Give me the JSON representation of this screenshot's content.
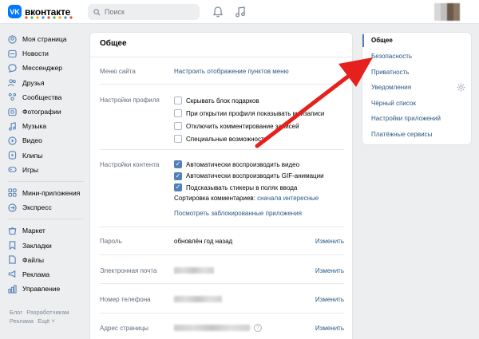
{
  "header": {
    "logo_mark": "VK",
    "logo_text": "вконтакте",
    "search_placeholder": "Поиск"
  },
  "nav": {
    "group1": [
      {
        "label": "Моя страница",
        "icon": "user-circle-icon"
      },
      {
        "label": "Новости",
        "icon": "news-icon"
      },
      {
        "label": "Мессенджер",
        "icon": "chat-icon"
      },
      {
        "label": "Друзья",
        "icon": "friends-icon"
      },
      {
        "label": "Сообщества",
        "icon": "communities-icon"
      },
      {
        "label": "Фотографии",
        "icon": "photo-icon"
      },
      {
        "label": "Музыка",
        "icon": "music-icon"
      },
      {
        "label": "Видео",
        "icon": "video-icon"
      },
      {
        "label": "Клипы",
        "icon": "clips-icon"
      },
      {
        "label": "Игры",
        "icon": "games-icon"
      }
    ],
    "group2": [
      {
        "label": "Мини-приложения",
        "icon": "apps-icon"
      },
      {
        "label": "Экспресс",
        "icon": "express-icon"
      }
    ],
    "group3": [
      {
        "label": "Маркет",
        "icon": "market-icon"
      },
      {
        "label": "Закладки",
        "icon": "bookmark-icon"
      },
      {
        "label": "Файлы",
        "icon": "files-icon"
      },
      {
        "label": "Реклама",
        "icon": "ads-icon"
      },
      {
        "label": "Управление",
        "icon": "manage-icon"
      }
    ],
    "footer": {
      "blog": "Блог",
      "developers": "Разработчикам",
      "ads": "Реклама",
      "more": "Ещё ˅"
    }
  },
  "card": {
    "title": "Общее",
    "site_menu_label": "Меню сайта",
    "site_menu_link": "Настроить отображение пунктов меню",
    "profile_label": "Настройки профиля",
    "profile_options": [
      {
        "label": "Скрывать блок подарков",
        "checked": false
      },
      {
        "label": "При открытии профиля показывать моизаписи",
        "checked": false
      },
      {
        "label": "Отключить комментирование записей",
        "checked": false
      },
      {
        "label": "Специальные возможности",
        "checked": false
      }
    ],
    "content_label": "Настройки контента",
    "content_options": [
      {
        "label": "Автоматически воспроизводить видео",
        "checked": true
      },
      {
        "label": "Автоматически воспроизводить GIF-анимации",
        "checked": true
      },
      {
        "label": "Подсказывать стикеры в полях ввода",
        "checked": true
      }
    ],
    "sort_label": "Сортировка комментариев:",
    "sort_value": "сначала интересные",
    "blocked_apps_link": "Посмотреть заблокированные приложения",
    "password_label": "Пароль",
    "password_value": "обновлён год назад",
    "email_label": "Электронная почта",
    "phone_label": "Номер телефона",
    "address_label": "Адрес страницы",
    "edit_label": "Изменить",
    "help_mark": "?"
  },
  "right_menu": {
    "active": "Общее",
    "items": [
      "Безопасность",
      "Приватность",
      "Уведомления",
      "Чёрный список",
      "Настройки приложений",
      "Платёжные сервисы"
    ]
  },
  "colors": {
    "accent": "#2a5885",
    "brand": "#0077ff",
    "arrow": "#e6201c",
    "checkbox_on": "#5181b8"
  }
}
